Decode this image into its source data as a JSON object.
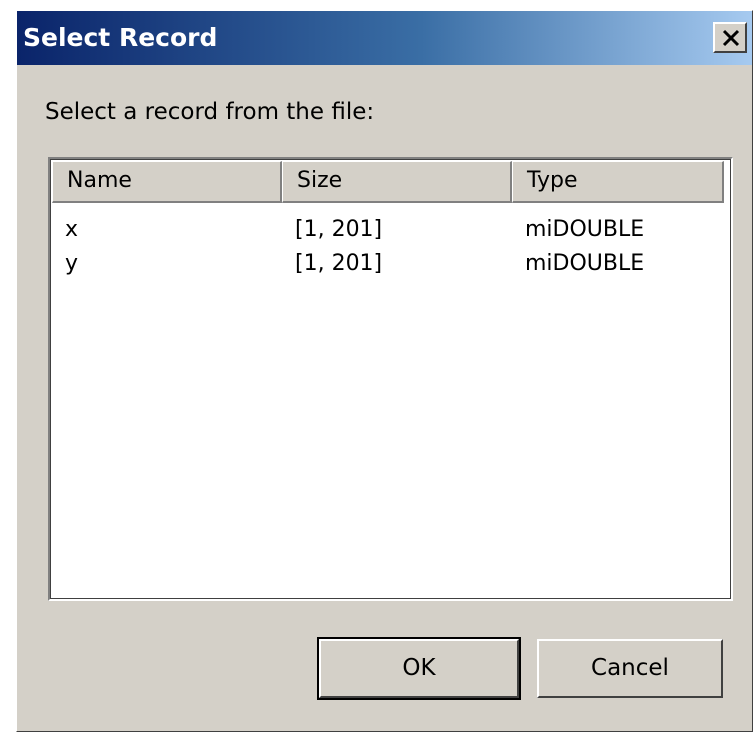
{
  "window": {
    "title": "Select Record",
    "close_icon": "close-icon"
  },
  "prompt": "Select a record from the file:",
  "list": {
    "columns": [
      "Name",
      "Size",
      "Type"
    ],
    "rows": [
      {
        "name": "x",
        "size": "[1, 201]",
        "type": "miDOUBLE"
      },
      {
        "name": "y",
        "size": "[1, 201]",
        "type": "miDOUBLE"
      }
    ]
  },
  "buttons": {
    "ok": "OK",
    "cancel": "Cancel"
  },
  "colors": {
    "title_gradient_start": "#0a246a",
    "title_gradient_end": "#a6caf0",
    "face": "#d4d0c8"
  }
}
